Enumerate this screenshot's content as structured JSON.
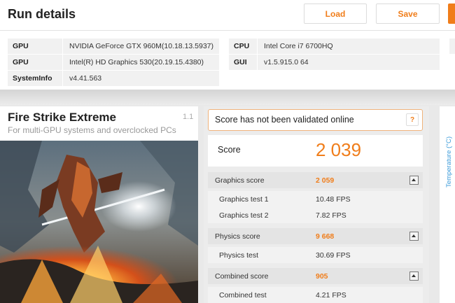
{
  "header": {
    "title": "Run details",
    "load_label": "Load",
    "save_label": "Save"
  },
  "system": {
    "left": [
      {
        "label": "GPU",
        "value": "NVIDIA GeForce GTX 960M(10.18.13.5937)"
      },
      {
        "label": "GPU",
        "value": "Intel(R) HD Graphics 530(20.19.15.4380)"
      },
      {
        "label": "SystemInfo",
        "value": "v4.41.563"
      }
    ],
    "right": [
      {
        "label": "CPU",
        "value": "Intel Core i7 6700HQ"
      },
      {
        "label": "GUI",
        "value": "v1.5.915.0 64"
      }
    ]
  },
  "benchmark": {
    "title": "Fire Strike Extreme",
    "subtitle": "For multi-GPU systems and overclocked PCs",
    "version": "1.1"
  },
  "results": {
    "validation_text": "Score has not been validated online",
    "help_label": "?",
    "score_label": "Score",
    "score_value": "2 039",
    "rows": [
      {
        "label": "Graphics score",
        "value": "2 059",
        "type": "head"
      },
      {
        "label": "Graphics test 1",
        "value": "10.48 FPS",
        "type": "sub"
      },
      {
        "label": "Graphics test 2",
        "value": "7.82 FPS",
        "type": "sub"
      },
      {
        "label": "Physics score",
        "value": "9 668",
        "type": "head"
      },
      {
        "label": "Physics test",
        "value": "30.69 FPS",
        "type": "sub"
      },
      {
        "label": "Combined score",
        "value": "905",
        "type": "head"
      },
      {
        "label": "Combined test",
        "value": "4.21 FPS",
        "type": "sub"
      }
    ]
  },
  "side": {
    "temperature_label": "Temperature (°C)"
  },
  "colors": {
    "accent": "#f07d1a",
    "link": "#3a9ad9"
  }
}
